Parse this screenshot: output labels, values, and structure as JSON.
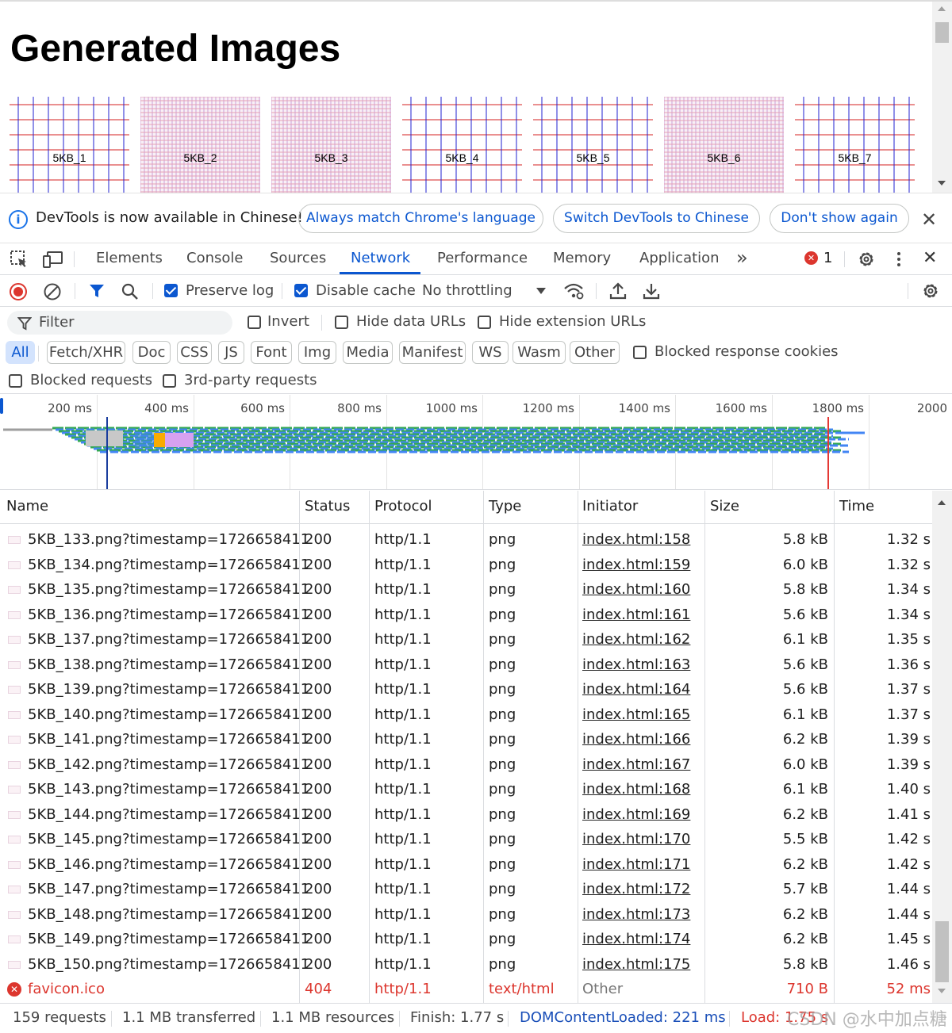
{
  "page": {
    "title": "Generated Images",
    "thumbnails": [
      {
        "label": "5KB_1",
        "variant": "coarse"
      },
      {
        "label": "5KB_2",
        "variant": "fine"
      },
      {
        "label": "5KB_3",
        "variant": "fine"
      },
      {
        "label": "5KB_4",
        "variant": "coarse"
      },
      {
        "label": "5KB_5",
        "variant": "coarse"
      },
      {
        "label": "5KB_6",
        "variant": "fine"
      },
      {
        "label": "5KB_7",
        "variant": "coarse"
      }
    ]
  },
  "infobar": {
    "message": "DevTools is now available in Chinese!",
    "match_button": "Always match Chrome's language",
    "switch_button": "Switch DevTools to Chinese",
    "dismiss_button": "Don't show again"
  },
  "tabs": {
    "elements": "Elements",
    "console": "Console",
    "sources": "Sources",
    "network": "Network",
    "performance": "Performance",
    "memory": "Memory",
    "application": "Application",
    "more": "»",
    "error_count": "1"
  },
  "toolbar": {
    "preserve_log": "Preserve log",
    "disable_cache": "Disable cache",
    "throttling": "No throttling"
  },
  "filters": {
    "filter_placeholder": "Filter",
    "invert": "Invert",
    "hide_data_urls": "Hide data URLs",
    "hide_extension_urls": "Hide extension URLs",
    "types": [
      "All",
      "Fetch/XHR",
      "Doc",
      "CSS",
      "JS",
      "Font",
      "Img",
      "Media",
      "Manifest",
      "WS",
      "Wasm",
      "Other"
    ],
    "blocked_response_cookies": "Blocked response cookies",
    "blocked_requests": "Blocked requests",
    "third_party_requests": "3rd-party requests"
  },
  "overview": {
    "ticks": [
      "200 ms",
      "400 ms",
      "600 ms",
      "800 ms",
      "1000 ms",
      "1200 ms",
      "1400 ms",
      "1600 ms",
      "1800 ms",
      "2000"
    ],
    "colors": {
      "waiting": "#34a853",
      "download": "#4285f4",
      "dom_content_loaded": "#1a3d9e",
      "load": "#e53935"
    }
  },
  "table": {
    "headers": {
      "name": "Name",
      "status": "Status",
      "protocol": "Protocol",
      "type": "Type",
      "initiator": "Initiator",
      "size": "Size",
      "time": "Time"
    },
    "rows": [
      {
        "name": "5KB_133.png?timestamp=1726658411",
        "status": "200",
        "protocol": "http/1.1",
        "type": "png",
        "initiator": "index.html:158",
        "size": "5.8 kB",
        "time": "1.32 s"
      },
      {
        "name": "5KB_134.png?timestamp=1726658411",
        "status": "200",
        "protocol": "http/1.1",
        "type": "png",
        "initiator": "index.html:159",
        "size": "6.0 kB",
        "time": "1.32 s"
      },
      {
        "name": "5KB_135.png?timestamp=1726658411",
        "status": "200",
        "protocol": "http/1.1",
        "type": "png",
        "initiator": "index.html:160",
        "size": "5.8 kB",
        "time": "1.34 s"
      },
      {
        "name": "5KB_136.png?timestamp=1726658411",
        "status": "200",
        "protocol": "http/1.1",
        "type": "png",
        "initiator": "index.html:161",
        "size": "5.6 kB",
        "time": "1.34 s"
      },
      {
        "name": "5KB_137.png?timestamp=1726658411",
        "status": "200",
        "protocol": "http/1.1",
        "type": "png",
        "initiator": "index.html:162",
        "size": "6.1 kB",
        "time": "1.35 s"
      },
      {
        "name": "5KB_138.png?timestamp=1726658411",
        "status": "200",
        "protocol": "http/1.1",
        "type": "png",
        "initiator": "index.html:163",
        "size": "5.6 kB",
        "time": "1.36 s"
      },
      {
        "name": "5KB_139.png?timestamp=1726658411",
        "status": "200",
        "protocol": "http/1.1",
        "type": "png",
        "initiator": "index.html:164",
        "size": "5.6 kB",
        "time": "1.37 s"
      },
      {
        "name": "5KB_140.png?timestamp=1726658411",
        "status": "200",
        "protocol": "http/1.1",
        "type": "png",
        "initiator": "index.html:165",
        "size": "6.1 kB",
        "time": "1.37 s"
      },
      {
        "name": "5KB_141.png?timestamp=1726658411",
        "status": "200",
        "protocol": "http/1.1",
        "type": "png",
        "initiator": "index.html:166",
        "size": "6.2 kB",
        "time": "1.39 s"
      },
      {
        "name": "5KB_142.png?timestamp=1726658411",
        "status": "200",
        "protocol": "http/1.1",
        "type": "png",
        "initiator": "index.html:167",
        "size": "6.0 kB",
        "time": "1.39 s"
      },
      {
        "name": "5KB_143.png?timestamp=1726658411",
        "status": "200",
        "protocol": "http/1.1",
        "type": "png",
        "initiator": "index.html:168",
        "size": "6.1 kB",
        "time": "1.40 s"
      },
      {
        "name": "5KB_144.png?timestamp=1726658411",
        "status": "200",
        "protocol": "http/1.1",
        "type": "png",
        "initiator": "index.html:169",
        "size": "6.2 kB",
        "time": "1.41 s"
      },
      {
        "name": "5KB_145.png?timestamp=1726658411",
        "status": "200",
        "protocol": "http/1.1",
        "type": "png",
        "initiator": "index.html:170",
        "size": "5.5 kB",
        "time": "1.42 s"
      },
      {
        "name": "5KB_146.png?timestamp=1726658411",
        "status": "200",
        "protocol": "http/1.1",
        "type": "png",
        "initiator": "index.html:171",
        "size": "6.2 kB",
        "time": "1.42 s"
      },
      {
        "name": "5KB_147.png?timestamp=1726658411",
        "status": "200",
        "protocol": "http/1.1",
        "type": "png",
        "initiator": "index.html:172",
        "size": "5.7 kB",
        "time": "1.44 s"
      },
      {
        "name": "5KB_148.png?timestamp=1726658411",
        "status": "200",
        "protocol": "http/1.1",
        "type": "png",
        "initiator": "index.html:173",
        "size": "6.2 kB",
        "time": "1.44 s"
      },
      {
        "name": "5KB_149.png?timestamp=1726658411",
        "status": "200",
        "protocol": "http/1.1",
        "type": "png",
        "initiator": "index.html:174",
        "size": "6.2 kB",
        "time": "1.45 s"
      },
      {
        "name": "5KB_150.png?timestamp=1726658411",
        "status": "200",
        "protocol": "http/1.1",
        "type": "png",
        "initiator": "index.html:175",
        "size": "5.8 kB",
        "time": "1.46 s"
      },
      {
        "name": "favicon.ico",
        "status": "404",
        "protocol": "http/1.1",
        "type": "text/html",
        "initiator": "Other",
        "size": "710 B",
        "time": "52 ms",
        "error": true
      }
    ]
  },
  "status": {
    "requests": "159 requests",
    "transferred": "1.1 MB transferred",
    "resources": "1.1 MB resources",
    "finish": "Finish: 1.77 s",
    "dom_content_loaded": "DOMContentLoaded: 221 ms",
    "load": "Load: 1.75 s",
    "watermark": "CSDN @水中加点糖"
  }
}
